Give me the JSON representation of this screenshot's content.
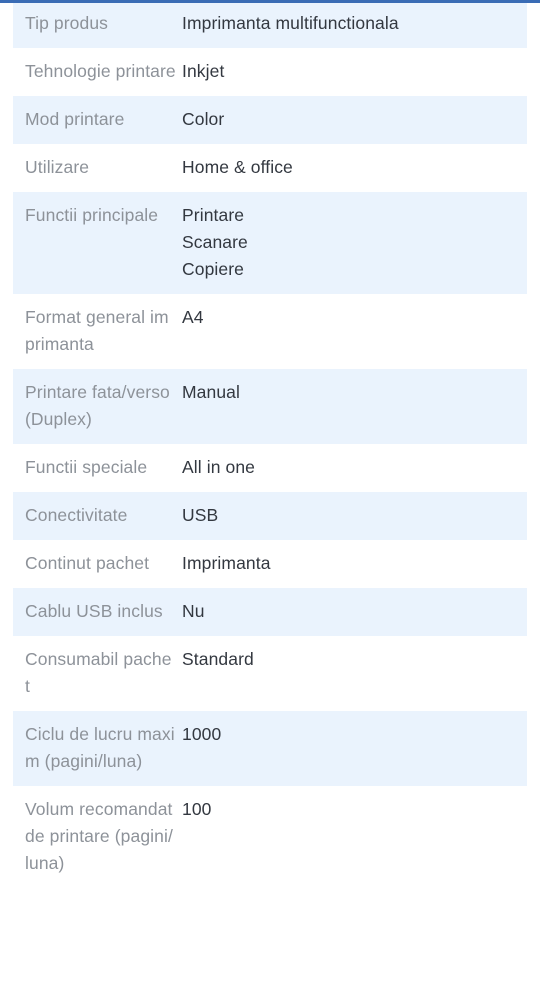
{
  "page": {
    "top_accent_color": "#3a6cb5",
    "shaded_row_color": "#eaf3fd",
    "label_color": "#8d9299",
    "value_color": "#333840"
  },
  "spec_table": {
    "rows": [
      {
        "label": "Tip produs",
        "value": "Imprimanta multifunctionala",
        "shaded": true
      },
      {
        "label": "Tehnologie printare",
        "value": "Inkjet",
        "shaded": false
      },
      {
        "label": "Mod printare",
        "value": "Color",
        "shaded": true
      },
      {
        "label": "Utilizare",
        "value": "Home & office",
        "shaded": false
      },
      {
        "label": "Functii principale",
        "value": "Printare\nScanare\nCopiere",
        "shaded": true
      },
      {
        "label": "Format general imprimanta",
        "value": "A4",
        "shaded": false
      },
      {
        "label": "Printare fata/verso (Duplex)",
        "value": "Manual",
        "shaded": true
      },
      {
        "label": "Functii speciale",
        "value": "All in one",
        "shaded": false
      },
      {
        "label": "Conectivitate",
        "value": "USB",
        "shaded": true
      },
      {
        "label": "Continut pachet",
        "value": "Imprimanta",
        "shaded": false
      },
      {
        "label": "Cablu USB inclus",
        "value": "Nu",
        "shaded": true
      },
      {
        "label": "Consumabil pachet",
        "value": "Standard",
        "shaded": false
      },
      {
        "label": "Ciclu de lucru maxim (pagini/luna)",
        "value": "1000",
        "shaded": true
      },
      {
        "label": "Volum recomandat de printare (pagini/luna)",
        "value": "100",
        "shaded": false
      }
    ]
  }
}
